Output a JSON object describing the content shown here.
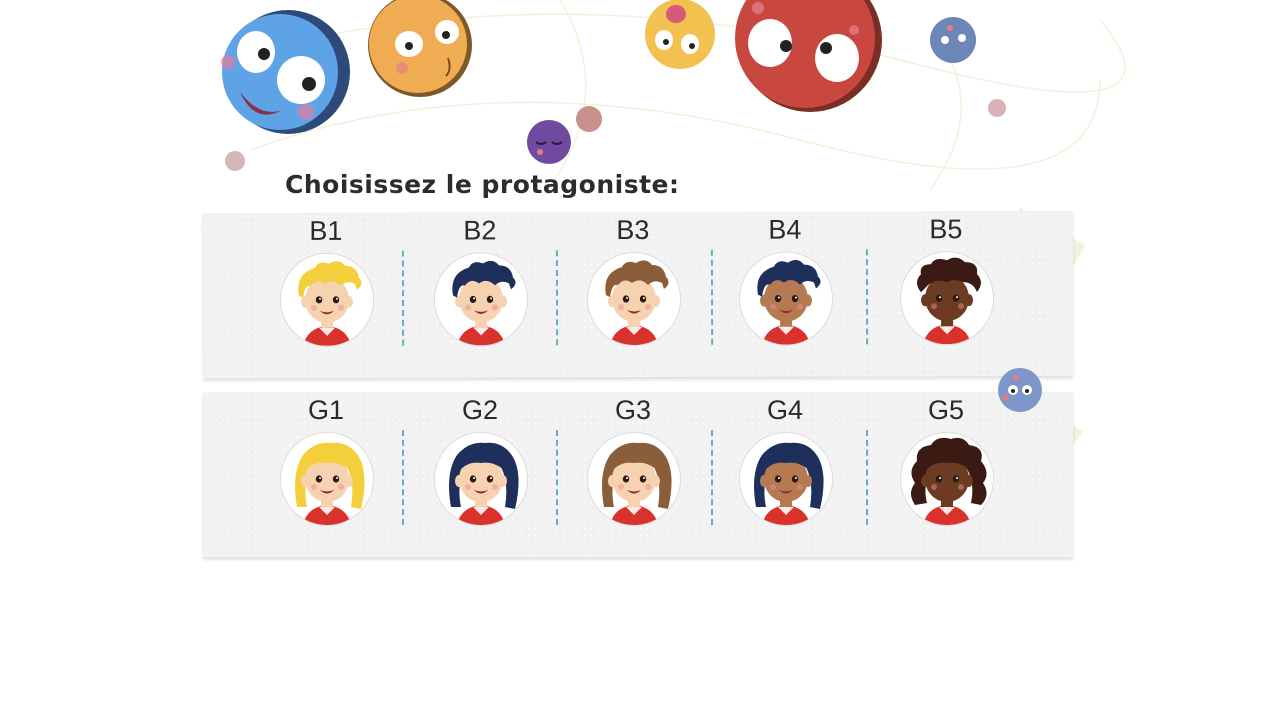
{
  "title": "Choisissez le protagoniste:",
  "boys": [
    {
      "label": "B1",
      "skin": "#f7d2b0",
      "hair": "#f3cf3c",
      "style": "spiky"
    },
    {
      "label": "B2",
      "skin": "#f7d2b0",
      "hair": "#1f2f5c",
      "style": "spiky"
    },
    {
      "label": "B3",
      "skin": "#f7d2b0",
      "hair": "#8a5d3b",
      "style": "spiky"
    },
    {
      "label": "B4",
      "skin": "#b57a52",
      "hair": "#1f2f5c",
      "style": "spiky"
    },
    {
      "label": "B5",
      "skin": "#6b3b22",
      "hair": "#3a1a12",
      "style": "curly"
    }
  ],
  "girls": [
    {
      "label": "G1",
      "skin": "#f7d2b0",
      "hair": "#f3cf3c",
      "style": "long"
    },
    {
      "label": "G2",
      "skin": "#f7d2b0",
      "hair": "#1f2f5c",
      "style": "long"
    },
    {
      "label": "G3",
      "skin": "#f7d2b0",
      "hair": "#8a5d3b",
      "style": "long"
    },
    {
      "label": "G4",
      "skin": "#b57a52",
      "hair": "#1f2f5c",
      "style": "long"
    },
    {
      "label": "G5",
      "skin": "#6b3b22",
      "hair": "#3a1a12",
      "style": "curly-long"
    }
  ],
  "colors": {
    "shirt": "#d9312b",
    "separator": "#5fb0c2"
  }
}
